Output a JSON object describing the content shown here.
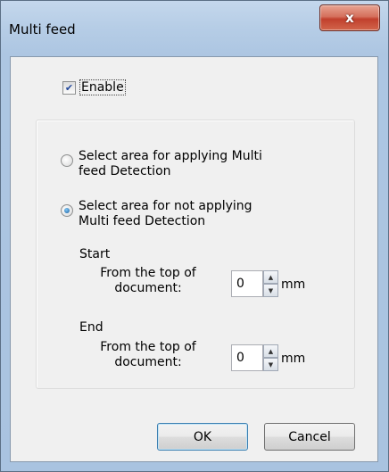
{
  "dialog": {
    "title": "Multi feed",
    "close_glyph": "x"
  },
  "enable": {
    "label": "Enable",
    "checked": true
  },
  "options": [
    {
      "line1": "Select area for applying Multi",
      "line2": "feed Detection",
      "selected": false
    },
    {
      "line1": "Select area for not applying",
      "line2": "Multi feed Detection",
      "selected": true
    }
  ],
  "start": {
    "title": "Start",
    "label_line1": "From the top of",
    "label_line2": "document:",
    "value": "0",
    "unit": "mm"
  },
  "end": {
    "title": "End",
    "label_line1": "From the top of",
    "label_line2": "document:",
    "value": "0",
    "unit": "mm"
  },
  "buttons": {
    "ok": "OK",
    "cancel": "Cancel"
  }
}
